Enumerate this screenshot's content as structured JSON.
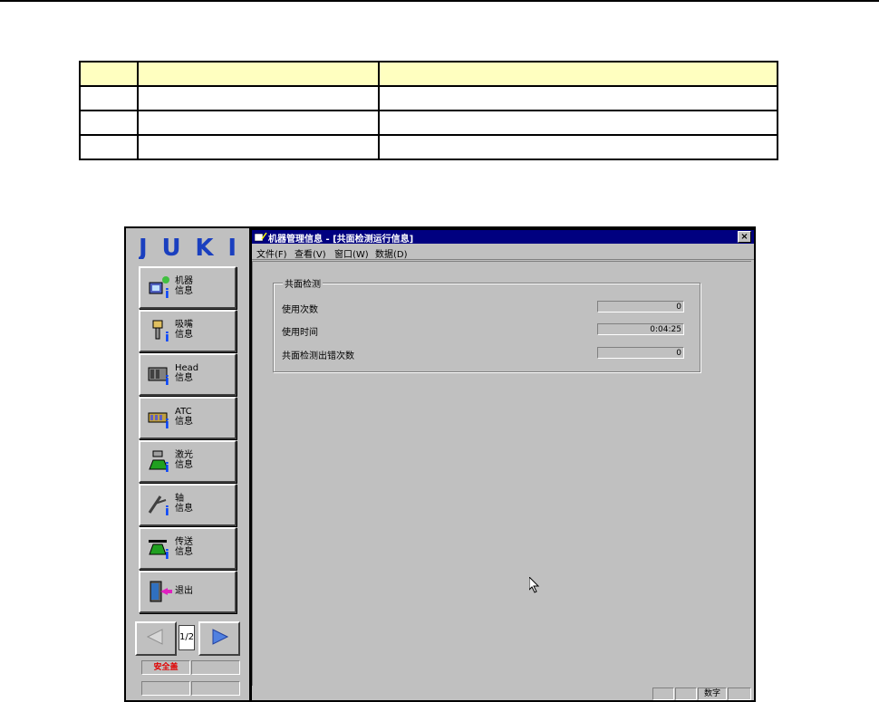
{
  "window": {
    "title": "机器管理信息 - [共面检测运行信息]",
    "close_label": "×"
  },
  "menu": [
    "文件(F)",
    "查看(V)",
    "窗口(W)",
    "数据(D)"
  ],
  "logo_text": "JUKI",
  "nav": [
    {
      "label": "机器\n信息",
      "icon": "machine-info-icon"
    },
    {
      "label": "吸嘴\n信息",
      "icon": "nozzle-info-icon"
    },
    {
      "label": "Head\n信息",
      "icon": "head-info-icon"
    },
    {
      "label": "ATC\n信息",
      "icon": "atc-info-icon"
    },
    {
      "label": "激光\n信息",
      "icon": "laser-info-icon"
    },
    {
      "label": "轴\n信息",
      "icon": "axis-info-icon"
    },
    {
      "label": "传送\n信息",
      "icon": "conveyor-info-icon"
    },
    {
      "label": "退出",
      "icon": "exit-icon"
    }
  ],
  "pager": {
    "page": "1/2"
  },
  "status_panel": {
    "safety": "安全盖"
  },
  "group": {
    "title": "共面检测",
    "rows": [
      {
        "label": "使用次数",
        "value": "0"
      },
      {
        "label": "使用时间",
        "value": "0:04:25"
      },
      {
        "label": "共面检测出错次数",
        "value": "0"
      }
    ]
  },
  "statusbar": {
    "mode": "数字"
  },
  "colors": {
    "titlebar": "#000080",
    "face": "#c0c0c0",
    "table_header": "#ffffc0",
    "logo_blue": "#1a3fbf"
  }
}
